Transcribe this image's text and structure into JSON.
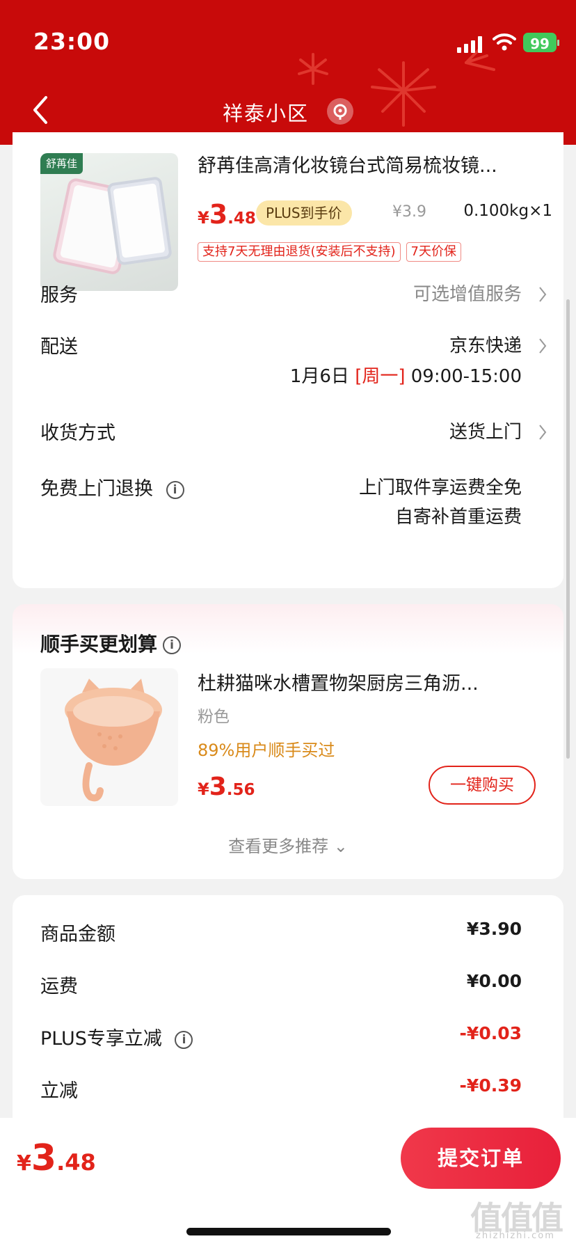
{
  "status": {
    "time": "23:00",
    "battery": "99"
  },
  "nav": {
    "title": "祥泰小区"
  },
  "product": {
    "brand": "舒苒佳",
    "title": "舒苒佳高清化妆镜台式简易梳妆镜...",
    "price_currency": "¥",
    "price_int": "3",
    "price_dec": ".48",
    "plus_tag": "PLUS到手价",
    "original_price": "¥3.9",
    "quantity": "0.100kg×1",
    "tags": [
      "支持7天无理由退货(安装后不支持)",
      "7天价保"
    ]
  },
  "rows": {
    "service": {
      "label": "服务",
      "value": "可选增值服务"
    },
    "delivery": {
      "label": "配送",
      "value": "京东快递",
      "date": "1月6日",
      "weekday": "[周一]",
      "time": "09:00-15:00"
    },
    "receive": {
      "label": "收货方式",
      "value": "送货上门"
    },
    "free_return": {
      "label": "免费上门退换",
      "line1": "上门取件享运费全免",
      "line2": "自寄补首重运费"
    }
  },
  "recommend": {
    "title": "顺手买更划算",
    "name": "杜耕猫咪水槽置物架厨房三角沥...",
    "color": "粉色",
    "buyers": "89%用户顺手买过",
    "price_currency": "¥",
    "price_int": "3",
    "price_dec": ".56",
    "buy_label": "一键购买",
    "more_label": "查看更多推荐"
  },
  "summary": {
    "items": [
      {
        "label": "商品金额",
        "value": "¥3.90",
        "highlight": false,
        "info": false
      },
      {
        "label": "运费",
        "value": "¥0.00",
        "highlight": false,
        "info": false
      },
      {
        "label": "PLUS专享立减",
        "value": "-¥0.03",
        "highlight": true,
        "info": true
      },
      {
        "label": "立减",
        "value": "-¥0.39",
        "highlight": true,
        "info": false
      }
    ]
  },
  "bottom": {
    "total_currency": "¥",
    "total_int": "3",
    "total_dec": ".48",
    "submit_label": "提交订单",
    "watermark": "值值值",
    "watermark_sub": "zhizhizhi.com"
  },
  "colors": {
    "header": "#c80a0a",
    "accent": "#e2231a",
    "plus": "#fbe6a8",
    "buyers": "#d98a1a"
  }
}
